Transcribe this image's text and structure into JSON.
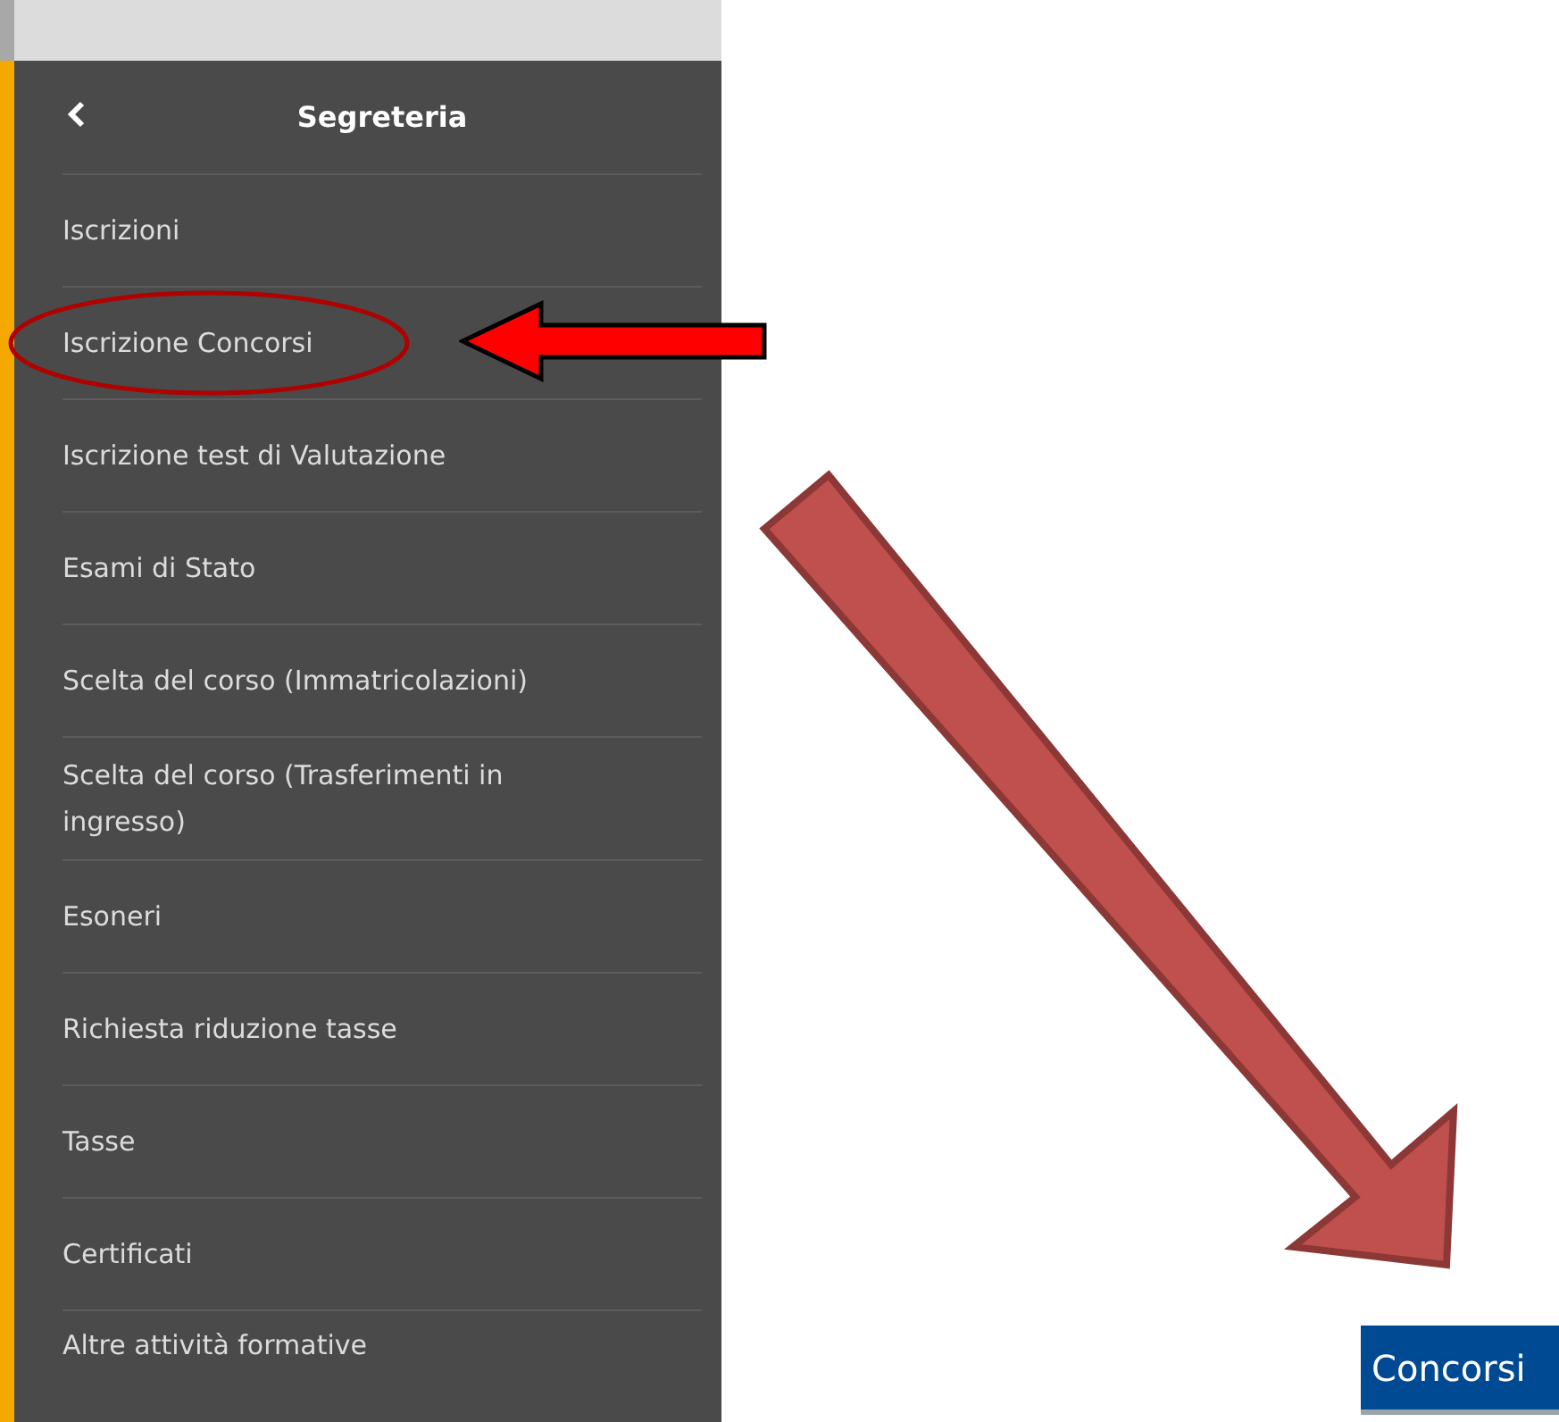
{
  "sidebar": {
    "title": "Segreteria",
    "items": [
      {
        "label": "Iscrizioni",
        "circled": false
      },
      {
        "label": "Iscrizione Concorsi",
        "circled": true
      },
      {
        "label": "Iscrizione test di Valutazione",
        "circled": false
      },
      {
        "label": "Esami di Stato",
        "circled": false
      },
      {
        "label": "Scelta del corso (Immatricolazioni)",
        "circled": false
      },
      {
        "label": "Scelta del corso (Trasferimenti in ingresso)",
        "circled": false
      },
      {
        "label": "Esoneri",
        "circled": false
      },
      {
        "label": "Richiesta riduzione tasse",
        "circled": false
      },
      {
        "label": "Tasse",
        "circled": false
      },
      {
        "label": "Certificati",
        "circled": false
      },
      {
        "label": "Altre attività formative",
        "circled": false
      }
    ]
  },
  "button": {
    "label": "Concorsi"
  }
}
